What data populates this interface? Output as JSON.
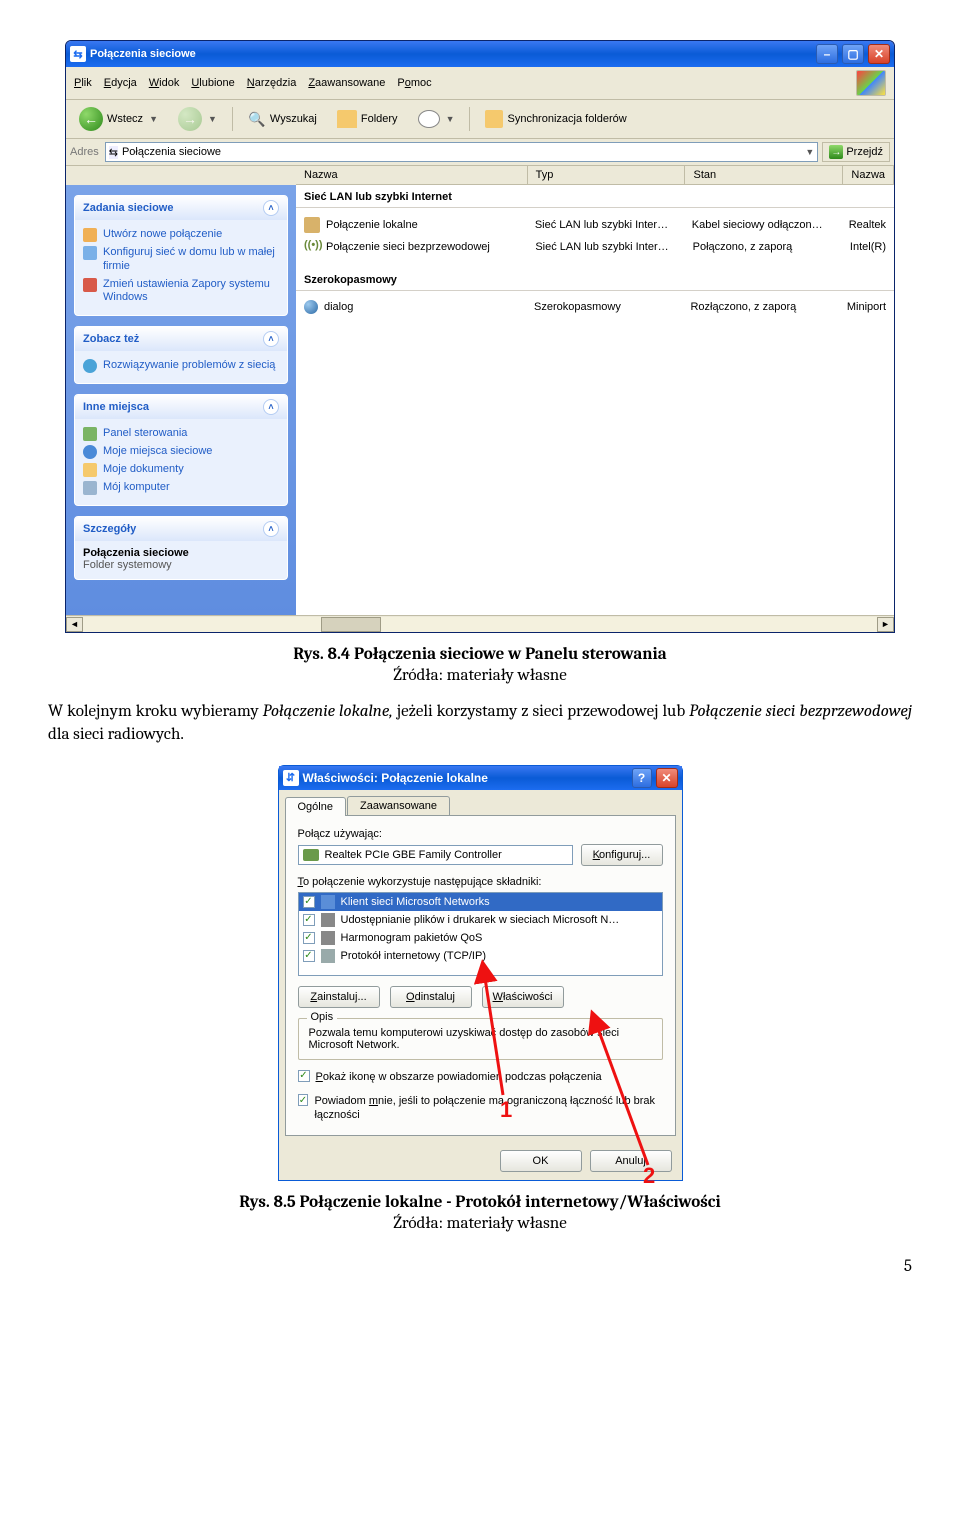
{
  "explorer": {
    "title": "Połączenia sieciowe",
    "menu": [
      "Plik",
      "Edycja",
      "Widok",
      "Ulubione",
      "Narzędzia",
      "Zaawansowane",
      "Pomoc"
    ],
    "menu_underline": [
      "P",
      "E",
      "W",
      "U",
      "N",
      "Z",
      "o"
    ],
    "toolbar": {
      "back": "Wstecz",
      "search": "Wyszukaj",
      "folders": "Foldery",
      "sync": "Synchronizacja folderów"
    },
    "address_label": "Adres",
    "address_value": "Połączenia sieciowe",
    "go_label": "Przejdź",
    "columns": {
      "name": "Nazwa",
      "type": "Typ",
      "state": "Stan",
      "name2": "Nazwa"
    },
    "side": {
      "tasks_title": "Zadania sieciowe",
      "tasks": [
        "Utwórz nowe połączenie",
        "Konfiguruj sieć w domu lub w małej firmie",
        "Zmień ustawienia Zapory systemu Windows"
      ],
      "see_also_title": "Zobacz też",
      "see_also": [
        "Rozwiązywanie problemów z siecią"
      ],
      "other_title": "Inne miejsca",
      "other": [
        "Panel sterowania",
        "Moje miejsca sieciowe",
        "Moje dokumenty",
        "Mój komputer"
      ],
      "details_title": "Szczegóły",
      "details_name": "Połączenia sieciowe",
      "details_kind": "Folder systemowy"
    },
    "groups": [
      {
        "header": "Sieć LAN lub szybki Internet",
        "rows": [
          {
            "icon": "lan",
            "name": "Połączenie lokalne",
            "type": "Sieć LAN lub szybki Inter…",
            "state": "Kabel sieciowy odłączon…",
            "name2": "Realtek"
          },
          {
            "icon": "wifi",
            "name": "Połączenie sieci bezprzewodowej",
            "type": "Sieć LAN lub szybki Inter…",
            "state": "Połączono, z zaporą",
            "name2": "Intel(R)"
          }
        ]
      },
      {
        "header": "Szerokopasmowy",
        "rows": [
          {
            "icon": "globe",
            "name": "dialog",
            "type": "Szerokopasmowy",
            "state": "Rozłączono, z zaporą",
            "name2": "Miniport"
          }
        ]
      }
    ]
  },
  "caption1": "Rys. 8.4 Połączenia sieciowe w Panelu sterowania",
  "source1": "Źródła: materiały własne",
  "paragraph": {
    "pre": "W kolejnym kroku wybieramy ",
    "em1": "Połączenie lokalne,",
    "mid": " jeżeli korzystamy z sieci przewodowej lub ",
    "em2": "Połączenie sieci bezprzewodowej",
    "post": " dla sieci radiowych."
  },
  "dialog": {
    "title": "Właściwości: Połączenie lokalne",
    "tabs": [
      "Ogólne",
      "Zaawansowane"
    ],
    "connect_using_label": "Połącz używając:",
    "nic_name": "Realtek PCIe GBE Family Controller",
    "configure_btn": "Konfiguruj...",
    "components_label": "To połączenie wykorzystuje następujące składniki:",
    "components": [
      "Klient sieci Microsoft Networks",
      "Udostępnianie plików i drukarek w sieciach Microsoft N…",
      "Harmonogram pakietów QoS",
      "Protokół internetowy (TCP/IP)"
    ],
    "install_btn": "Zainstaluj...",
    "uninstall_btn": "Odinstaluj",
    "properties_btn": "Właściwości",
    "desc_legend": "Opis",
    "desc_text": "Pozwala temu komputerowi uzyskiwać dostęp do zasobów sieci Microsoft Network.",
    "show_icon": "Pokaż ikonę w obszarze powiadomień podczas połączenia",
    "notify_limited": "Powiadom mnie, jeśli to połączenie ma ograniczoną łączność lub brak łączności",
    "ok_btn": "OK",
    "cancel_btn": "Anuluj",
    "annot1": "1",
    "annot2": "2"
  },
  "caption2": "Rys. 8.5 Połączenie lokalne - Protokół internetowy/Właściwości",
  "source2": "Źródła: materiały własne",
  "page_number": "5"
}
